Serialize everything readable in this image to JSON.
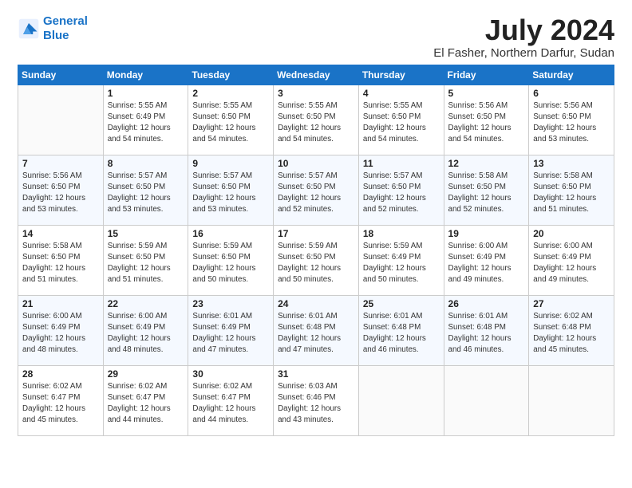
{
  "header": {
    "logo_line1": "General",
    "logo_line2": "Blue",
    "title": "July 2024",
    "subtitle": "El Fasher, Northern Darfur, Sudan"
  },
  "weekdays": [
    "Sunday",
    "Monday",
    "Tuesday",
    "Wednesday",
    "Thursday",
    "Friday",
    "Saturday"
  ],
  "weeks": [
    [
      {
        "day": "",
        "info": ""
      },
      {
        "day": "1",
        "info": "Sunrise: 5:55 AM\nSunset: 6:49 PM\nDaylight: 12 hours\nand 54 minutes."
      },
      {
        "day": "2",
        "info": "Sunrise: 5:55 AM\nSunset: 6:50 PM\nDaylight: 12 hours\nand 54 minutes."
      },
      {
        "day": "3",
        "info": "Sunrise: 5:55 AM\nSunset: 6:50 PM\nDaylight: 12 hours\nand 54 minutes."
      },
      {
        "day": "4",
        "info": "Sunrise: 5:55 AM\nSunset: 6:50 PM\nDaylight: 12 hours\nand 54 minutes."
      },
      {
        "day": "5",
        "info": "Sunrise: 5:56 AM\nSunset: 6:50 PM\nDaylight: 12 hours\nand 54 minutes."
      },
      {
        "day": "6",
        "info": "Sunrise: 5:56 AM\nSunset: 6:50 PM\nDaylight: 12 hours\nand 53 minutes."
      }
    ],
    [
      {
        "day": "7",
        "info": "Sunrise: 5:56 AM\nSunset: 6:50 PM\nDaylight: 12 hours\nand 53 minutes."
      },
      {
        "day": "8",
        "info": "Sunrise: 5:57 AM\nSunset: 6:50 PM\nDaylight: 12 hours\nand 53 minutes."
      },
      {
        "day": "9",
        "info": "Sunrise: 5:57 AM\nSunset: 6:50 PM\nDaylight: 12 hours\nand 53 minutes."
      },
      {
        "day": "10",
        "info": "Sunrise: 5:57 AM\nSunset: 6:50 PM\nDaylight: 12 hours\nand 52 minutes."
      },
      {
        "day": "11",
        "info": "Sunrise: 5:57 AM\nSunset: 6:50 PM\nDaylight: 12 hours\nand 52 minutes."
      },
      {
        "day": "12",
        "info": "Sunrise: 5:58 AM\nSunset: 6:50 PM\nDaylight: 12 hours\nand 52 minutes."
      },
      {
        "day": "13",
        "info": "Sunrise: 5:58 AM\nSunset: 6:50 PM\nDaylight: 12 hours\nand 51 minutes."
      }
    ],
    [
      {
        "day": "14",
        "info": "Sunrise: 5:58 AM\nSunset: 6:50 PM\nDaylight: 12 hours\nand 51 minutes."
      },
      {
        "day": "15",
        "info": "Sunrise: 5:59 AM\nSunset: 6:50 PM\nDaylight: 12 hours\nand 51 minutes."
      },
      {
        "day": "16",
        "info": "Sunrise: 5:59 AM\nSunset: 6:50 PM\nDaylight: 12 hours\nand 50 minutes."
      },
      {
        "day": "17",
        "info": "Sunrise: 5:59 AM\nSunset: 6:50 PM\nDaylight: 12 hours\nand 50 minutes."
      },
      {
        "day": "18",
        "info": "Sunrise: 5:59 AM\nSunset: 6:49 PM\nDaylight: 12 hours\nand 50 minutes."
      },
      {
        "day": "19",
        "info": "Sunrise: 6:00 AM\nSunset: 6:49 PM\nDaylight: 12 hours\nand 49 minutes."
      },
      {
        "day": "20",
        "info": "Sunrise: 6:00 AM\nSunset: 6:49 PM\nDaylight: 12 hours\nand 49 minutes."
      }
    ],
    [
      {
        "day": "21",
        "info": "Sunrise: 6:00 AM\nSunset: 6:49 PM\nDaylight: 12 hours\nand 48 minutes."
      },
      {
        "day": "22",
        "info": "Sunrise: 6:00 AM\nSunset: 6:49 PM\nDaylight: 12 hours\nand 48 minutes."
      },
      {
        "day": "23",
        "info": "Sunrise: 6:01 AM\nSunset: 6:49 PM\nDaylight: 12 hours\nand 47 minutes."
      },
      {
        "day": "24",
        "info": "Sunrise: 6:01 AM\nSunset: 6:48 PM\nDaylight: 12 hours\nand 47 minutes."
      },
      {
        "day": "25",
        "info": "Sunrise: 6:01 AM\nSunset: 6:48 PM\nDaylight: 12 hours\nand 46 minutes."
      },
      {
        "day": "26",
        "info": "Sunrise: 6:01 AM\nSunset: 6:48 PM\nDaylight: 12 hours\nand 46 minutes."
      },
      {
        "day": "27",
        "info": "Sunrise: 6:02 AM\nSunset: 6:48 PM\nDaylight: 12 hours\nand 45 minutes."
      }
    ],
    [
      {
        "day": "28",
        "info": "Sunrise: 6:02 AM\nSunset: 6:47 PM\nDaylight: 12 hours\nand 45 minutes."
      },
      {
        "day": "29",
        "info": "Sunrise: 6:02 AM\nSunset: 6:47 PM\nDaylight: 12 hours\nand 44 minutes."
      },
      {
        "day": "30",
        "info": "Sunrise: 6:02 AM\nSunset: 6:47 PM\nDaylight: 12 hours\nand 44 minutes."
      },
      {
        "day": "31",
        "info": "Sunrise: 6:03 AM\nSunset: 6:46 PM\nDaylight: 12 hours\nand 43 minutes."
      },
      {
        "day": "",
        "info": ""
      },
      {
        "day": "",
        "info": ""
      },
      {
        "day": "",
        "info": ""
      }
    ]
  ]
}
